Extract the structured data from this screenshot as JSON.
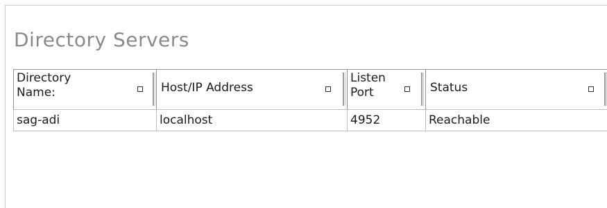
{
  "page": {
    "title": "Directory Servers"
  },
  "table": {
    "columns": [
      {
        "label": "Directory Name:",
        "line1": "Directory",
        "line2": "Name:"
      },
      {
        "label": "Host/IP Address"
      },
      {
        "label": "Listen Port",
        "line1": "Listen",
        "line2": "Port"
      },
      {
        "label": "Status"
      }
    ],
    "rows": [
      {
        "directory_name": "sag-adi",
        "host": "localhost",
        "port": "4952",
        "status": "Reachable"
      }
    ]
  },
  "icons": {
    "sort": "sort-icon",
    "scroll_left": "scroll-left-icon",
    "scroll_right": "scroll-right-icon"
  },
  "colors": {
    "title": "#8a8a8a",
    "grid_line": "#bdbdbd",
    "text": "#1a1a1a"
  }
}
